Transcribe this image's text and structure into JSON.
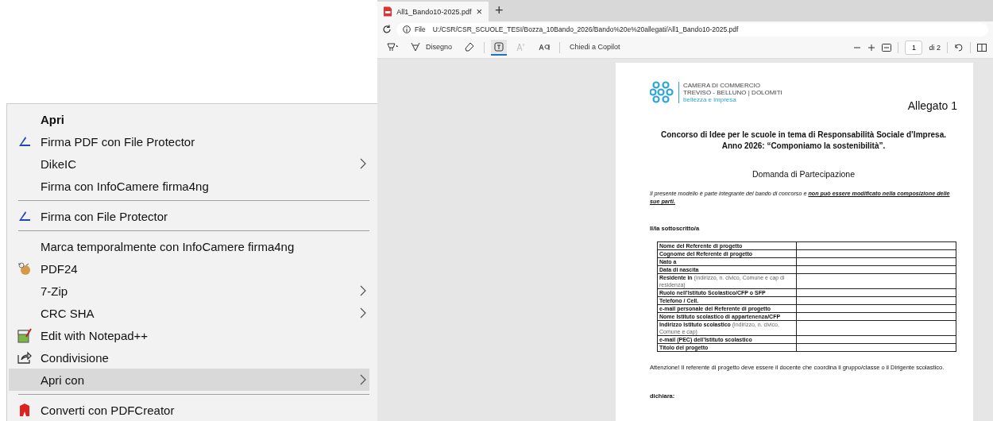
{
  "browser": {
    "tab": {
      "title": "All1_Bando10-2025.pdf",
      "close": "×",
      "new_tab": "+"
    },
    "address": {
      "scheme": "File",
      "url": "U:/CSR/CSR_SCUOLE_TESI/Bozza_10Bando_2026/Bando%20e%20allegati/All1_Bando10-2025.pdf"
    },
    "toolbar": {
      "tools": [
        {
          "kind": "highlight",
          "selected": false,
          "disabled": false
        },
        {
          "kind": "draw",
          "label": "Disegno",
          "selected": false,
          "disabled": false
        },
        {
          "kind": "erase",
          "selected": false,
          "disabled": false
        },
        {
          "kind": "text",
          "selected": true,
          "disabled": false
        },
        {
          "kind": "read",
          "selected": false,
          "disabled": true
        },
        {
          "kind": "translate",
          "selected": false,
          "disabled": false
        },
        {
          "kind": "copilot",
          "label": "Chiedi a Copilot",
          "selected": false,
          "disabled": false
        }
      ],
      "page_value": "1",
      "page_total": "di 2"
    }
  },
  "document": {
    "logo_lines": [
      "CAMERA DI COMMERCIO",
      "TREVISO - BELLUNO | DOLOMITI",
      "bellezza e impresa"
    ],
    "attachment": "Allegato 1",
    "title_lines": [
      "Concorso di Idee per le scuole in tema di Responsabilità Sociale d’Impresa.",
      "Anno 2026: “Componiamo la sostenibilità”."
    ],
    "subtitle": "Domanda di Partecipazione",
    "note": "Il presente modello è parte integrante del bando di concorso e **non può essere modificato nella composizione delle sue parti.**",
    "signer": "Il/la sottoscritto/a",
    "form_rows": [
      "**Nome del Referente di progetto**",
      "**Cognome del Referente di progetto**",
      "**Nato a**",
      "**Data di nascita**",
      "**Residente in** (indirizzo, n. civico, Comune e cap di residenza)",
      "**Ruolo nell’Istituto Scolastico/CFP o SFP**",
      "**Telefono / Cell.**",
      "**e-mail personale del Referente di progetto**",
      "**Nome Istituto scolastico di appartenenza/CFP**",
      "**Indirizzo Istituto scolastico** (indirizzo, n. civico, Comune e cap)",
      "**e-mail (PEC) dell’Istituto scolastico**",
      "**Titolo del progetto**"
    ],
    "warning": "Attenzione! Il referente di progetto deve essere il docente che coordina il gruppo/classe o il Dirigente scolastico.",
    "declares": "dichiara:"
  },
  "context_menu": [
    {
      "kind": "default",
      "label": "Apri",
      "submenu": false,
      "selected": false
    },
    {
      "kind": "protector",
      "label": "Firma PDF con File Protector",
      "submenu": false,
      "selected": false
    },
    {
      "kind": "plain",
      "label": "DikeIC",
      "submenu": true,
      "selected": false
    },
    {
      "kind": "plain",
      "label": "Firma con InfoCamere firma4ng",
      "submenu": false,
      "selected": false
    },
    {
      "kind": "separator"
    },
    {
      "kind": "protector",
      "label": "Firma con File Protector",
      "submenu": false,
      "selected": false
    },
    {
      "kind": "separator"
    },
    {
      "kind": "plain",
      "label": "Marca temporalmente con InfoCamere firma4ng",
      "submenu": false,
      "selected": false
    },
    {
      "kind": "pdf24",
      "label": "PDF24",
      "submenu": false,
      "selected": false
    },
    {
      "kind": "plain",
      "label": "7-Zip",
      "submenu": true,
      "selected": false
    },
    {
      "kind": "plain",
      "label": "CRC SHA",
      "submenu": true,
      "selected": false
    },
    {
      "kind": "notepad",
      "label": "Edit with Notepad++",
      "submenu": false,
      "selected": false
    },
    {
      "kind": "share",
      "label": "Condivisione",
      "submenu": false,
      "selected": false
    },
    {
      "kind": "plain",
      "label": "Apri con",
      "submenu": true,
      "selected": true
    },
    {
      "kind": "separator"
    },
    {
      "kind": "pdfcreator",
      "label": "Converti con PDFCreator",
      "submenu": false,
      "selected": false
    }
  ]
}
